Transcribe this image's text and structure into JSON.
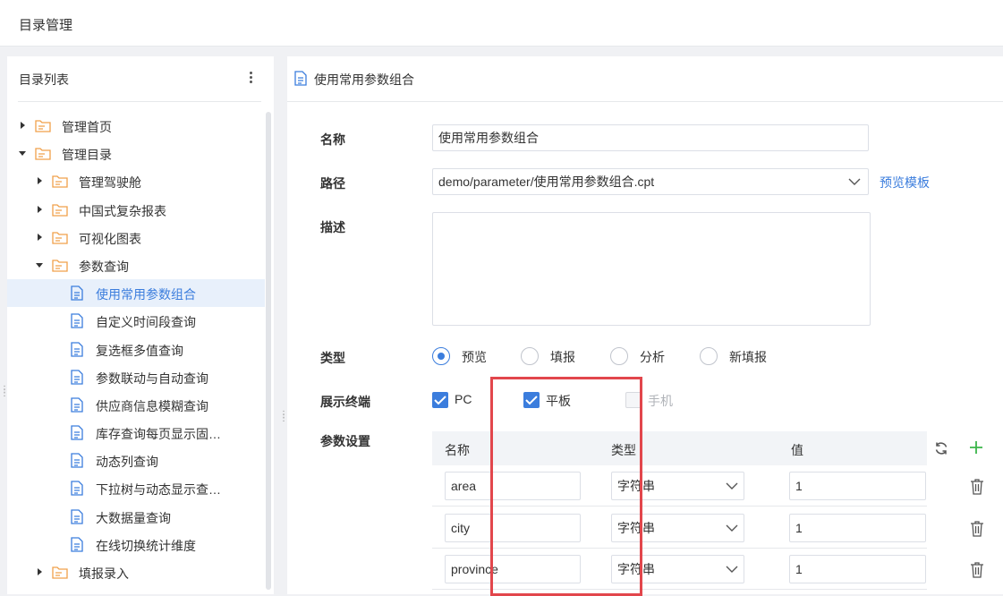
{
  "topbar": {
    "title": "目录管理"
  },
  "sidebar": {
    "title": "目录列表",
    "tree": [
      {
        "label": "管理首页",
        "kind": "folder",
        "level": 0,
        "expanded": false
      },
      {
        "label": "管理目录",
        "kind": "folder",
        "level": 0,
        "expanded": true
      },
      {
        "label": "管理驾驶舱",
        "kind": "folder",
        "level": 1,
        "expanded": false
      },
      {
        "label": "中国式复杂报表",
        "kind": "folder",
        "level": 1,
        "expanded": false
      },
      {
        "label": "可视化图表",
        "kind": "folder",
        "level": 1,
        "expanded": false
      },
      {
        "label": "参数查询",
        "kind": "folder",
        "level": 1,
        "expanded": true
      },
      {
        "label": "使用常用参数组合",
        "kind": "doc",
        "level": 2,
        "active": true
      },
      {
        "label": "自定义时间段查询",
        "kind": "doc",
        "level": 2
      },
      {
        "label": "复选框多值查询",
        "kind": "doc",
        "level": 2
      },
      {
        "label": "参数联动与自动查询",
        "kind": "doc",
        "level": 2
      },
      {
        "label": "供应商信息模糊查询",
        "kind": "doc",
        "level": 2
      },
      {
        "label": "库存查询每页显示固…",
        "kind": "doc",
        "level": 2
      },
      {
        "label": "动态列查询",
        "kind": "doc",
        "level": 2
      },
      {
        "label": "下拉树与动态显示查…",
        "kind": "doc",
        "level": 2
      },
      {
        "label": "大数据量查询",
        "kind": "doc",
        "level": 2
      },
      {
        "label": "在线切换统计维度",
        "kind": "doc",
        "level": 2
      },
      {
        "label": "填报录入",
        "kind": "folder",
        "level": 1,
        "expanded": false
      }
    ]
  },
  "detail": {
    "title": "使用常用参数组合",
    "name_label": "名称",
    "name_value": "使用常用参数组合",
    "path_label": "路径",
    "path_value": "demo/parameter/使用常用参数组合.cpt",
    "preview_link": "预览模板",
    "desc_label": "描述",
    "desc_value": "",
    "type_label": "类型",
    "types": [
      {
        "label": "预览",
        "selected": true
      },
      {
        "label": "填报",
        "selected": false
      },
      {
        "label": "分析",
        "selected": false
      },
      {
        "label": "新填报",
        "selected": false
      }
    ],
    "terminal_label": "展示终端",
    "terminals": [
      {
        "label": "PC",
        "checked": true,
        "disabled": false
      },
      {
        "label": "平板",
        "checked": true,
        "disabled": false
      },
      {
        "label": "手机",
        "checked": false,
        "disabled": true
      }
    ],
    "params_label": "参数设置",
    "params_headers": {
      "name": "名称",
      "type": "类型",
      "value": "值"
    },
    "params": [
      {
        "name": "area",
        "type": "字符串",
        "value": "1"
      },
      {
        "name": "city",
        "type": "字符串",
        "value": "1"
      },
      {
        "name": "province",
        "type": "字符串",
        "value": "1"
      }
    ]
  },
  "colors": {
    "accent": "#3b7ddd",
    "folder": "#f0a04a",
    "highlight": "#e2464c",
    "add": "#3bb54a"
  }
}
